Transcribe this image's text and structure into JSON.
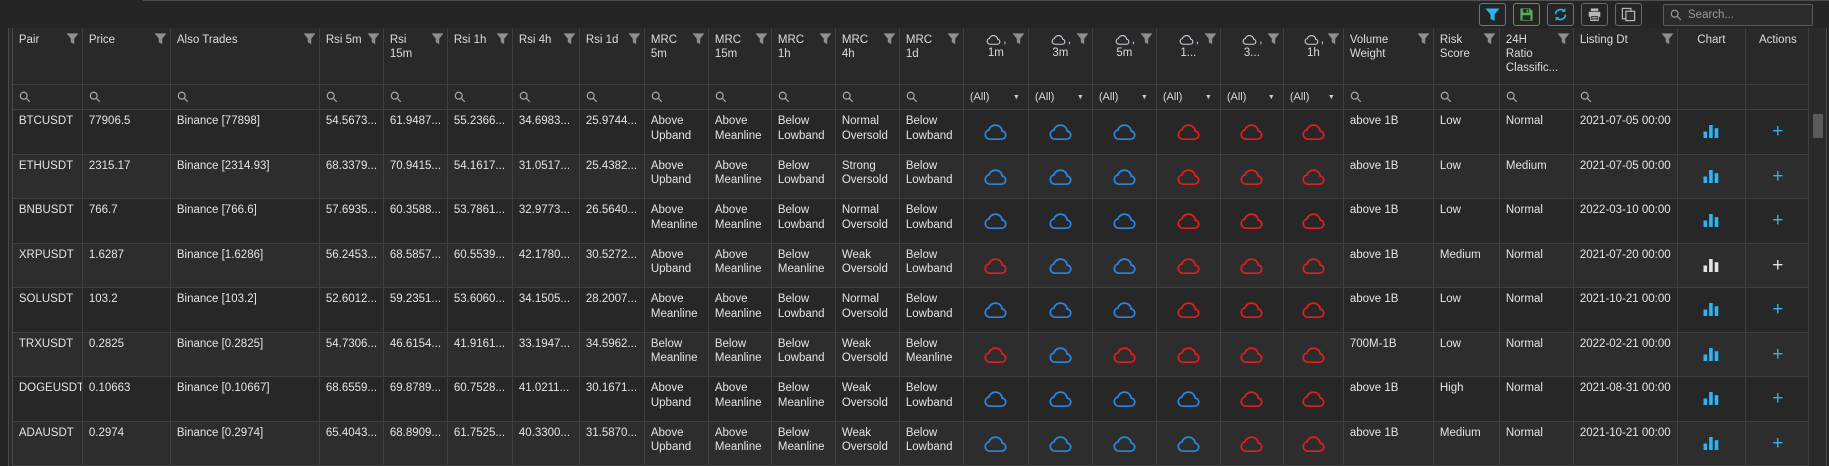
{
  "toolbar": {
    "search": {
      "placeholder": "Search..."
    },
    "buttons": [
      {
        "id": "filter",
        "icon": "funnel-icon",
        "style": "cyan"
      },
      {
        "id": "save-layout",
        "icon": "save-icon",
        "style": "green"
      },
      {
        "id": "refresh",
        "icon": "refresh-icon",
        "style": "cyan"
      },
      {
        "id": "print",
        "icon": "printer-icon",
        "style": "gray"
      },
      {
        "id": "copy",
        "icon": "copy-icon",
        "style": "gray"
      }
    ]
  },
  "table": {
    "filter_all_label": "(All)",
    "cloud_comma": ",",
    "columns": [
      {
        "id": "pair",
        "label": "Pair",
        "label_lines": [
          "Pair"
        ],
        "filter": "search",
        "funnel": true,
        "kind": "text"
      },
      {
        "id": "price",
        "label": "Price",
        "label_lines": [
          "Price"
        ],
        "filter": "search",
        "funnel": true,
        "kind": "text"
      },
      {
        "id": "also_trades",
        "label": "Also Trades",
        "label_lines": [
          "Also Trades"
        ],
        "filter": "search",
        "funnel": true,
        "kind": "text"
      },
      {
        "id": "rsi_5m",
        "label": "Rsi 5m",
        "label_lines": [
          "Rsi 5m"
        ],
        "filter": "search",
        "funnel": true,
        "kind": "text"
      },
      {
        "id": "rsi_15m",
        "label": "Rsi 15m",
        "label_lines": [
          "Rsi",
          "15m"
        ],
        "filter": "search",
        "funnel": true,
        "kind": "text"
      },
      {
        "id": "rsi_1h",
        "label": "Rsi 1h",
        "label_lines": [
          "Rsi 1h"
        ],
        "filter": "search",
        "funnel": true,
        "kind": "text"
      },
      {
        "id": "rsi_4h",
        "label": "Rsi 4h",
        "label_lines": [
          "Rsi 4h"
        ],
        "filter": "search",
        "funnel": true,
        "kind": "text"
      },
      {
        "id": "rsi_1d",
        "label": "Rsi 1d",
        "label_lines": [
          "Rsi 1d"
        ],
        "filter": "search",
        "funnel": true,
        "kind": "text"
      },
      {
        "id": "mrc_5m",
        "label": "MRC 5m",
        "label_lines": [
          "MRC",
          "5m"
        ],
        "filter": "search",
        "funnel": true,
        "kind": "text"
      },
      {
        "id": "mrc_15m",
        "label": "MRC 15m",
        "label_lines": [
          "MRC",
          "15m"
        ],
        "filter": "search",
        "funnel": true,
        "kind": "text"
      },
      {
        "id": "mrc_1h",
        "label": "MRC 1h",
        "label_lines": [
          "MRC",
          "1h"
        ],
        "filter": "search",
        "funnel": true,
        "kind": "text"
      },
      {
        "id": "mrc_4h",
        "label": "MRC 4h",
        "label_lines": [
          "MRC",
          "4h"
        ],
        "filter": "search",
        "funnel": true,
        "kind": "text"
      },
      {
        "id": "mrc_1d",
        "label": "MRC 1d",
        "label_lines": [
          "MRC",
          "1d"
        ],
        "filter": "search",
        "funnel": true,
        "kind": "text"
      },
      {
        "id": "cloud_1m",
        "label": "1m",
        "label_lines": [
          "1m"
        ],
        "cloud_header": true,
        "filter": "all",
        "funnel": true,
        "kind": "cloud"
      },
      {
        "id": "cloud_3m",
        "label": "3m",
        "label_lines": [
          "3m"
        ],
        "cloud_header": true,
        "filter": "all",
        "funnel": true,
        "kind": "cloud"
      },
      {
        "id": "cloud_5m",
        "label": "5m",
        "label_lines": [
          "5m"
        ],
        "cloud_header": true,
        "filter": "all",
        "funnel": true,
        "kind": "cloud"
      },
      {
        "id": "cloud_1x",
        "label": "1...",
        "label_lines": [
          "1..."
        ],
        "cloud_header": true,
        "filter": "all",
        "funnel": true,
        "kind": "cloud"
      },
      {
        "id": "cloud_3x",
        "label": "3...",
        "label_lines": [
          "3..."
        ],
        "cloud_header": true,
        "filter": "all",
        "funnel": true,
        "kind": "cloud"
      },
      {
        "id": "cloud_1h",
        "label": "1h",
        "label_lines": [
          "1h"
        ],
        "cloud_header": true,
        "filter": "all",
        "funnel": true,
        "kind": "cloud"
      },
      {
        "id": "volume_weight",
        "label": "Volume Weight",
        "label_lines": [
          "Volume",
          "Weight"
        ],
        "filter": "search",
        "funnel": true,
        "kind": "text"
      },
      {
        "id": "risk_score",
        "label": "Risk Score",
        "label_lines": [
          "Risk",
          "Score"
        ],
        "filter": "search",
        "funnel": true,
        "kind": "text"
      },
      {
        "id": "ratio_24h",
        "label": "24H Ratio Classific...",
        "label_lines": [
          "24H",
          "Ratio",
          "Classific..."
        ],
        "filter": "search",
        "funnel": true,
        "kind": "text"
      },
      {
        "id": "listing_dt",
        "label": "Listing Dt",
        "label_lines": [
          "Listing Dt"
        ],
        "filter": "search",
        "funnel": true,
        "kind": "text"
      },
      {
        "id": "chart",
        "label": "Chart",
        "label_lines": [
          "Chart"
        ],
        "filter": "none",
        "funnel": false,
        "kind": "chart"
      },
      {
        "id": "actions",
        "label": "Actions",
        "label_lines": [
          "Actions"
        ],
        "filter": "none",
        "funnel": false,
        "kind": "action"
      }
    ],
    "rows": [
      {
        "pair": "BTCUSDT",
        "price": "77906.5",
        "also_trades": "Binance [77898]",
        "rsi_5m": "54.5673...",
        "rsi_15m": "61.9487...",
        "rsi_1h": "55.2366...",
        "rsi_4h": "34.6983...",
        "rsi_1d": "25.9744...",
        "mrc_5m": "Above Upband",
        "mrc_15m": "Above Meanline",
        "mrc_1h": "Below Lowband",
        "mrc_4h": "Normal Oversold",
        "mrc_1d": "Below Lowband",
        "cloud_1m": "blue",
        "cloud_3m": "blue",
        "cloud_5m": "blue",
        "cloud_1x": "red",
        "cloud_3x": "red",
        "cloud_1h": "red",
        "volume_weight": "above 1B",
        "risk_score": "Low",
        "ratio_24h": "Normal",
        "listing_dt": "2021-07-05 00:00",
        "chart": "blue",
        "actions": "blue"
      },
      {
        "pair": "ETHUSDT",
        "price": "2315.17",
        "also_trades": "Binance [2314.93]",
        "rsi_5m": "68.3379...",
        "rsi_15m": "70.9415...",
        "rsi_1h": "54.1617...",
        "rsi_4h": "31.0517...",
        "rsi_1d": "25.4382...",
        "mrc_5m": "Above Upband",
        "mrc_15m": "Above Meanline",
        "mrc_1h": "Below Lowband",
        "mrc_4h": "Strong Oversold",
        "mrc_1d": "Below Lowband",
        "cloud_1m": "blue",
        "cloud_3m": "blue",
        "cloud_5m": "blue",
        "cloud_1x": "red",
        "cloud_3x": "red",
        "cloud_1h": "red",
        "volume_weight": "above 1B",
        "risk_score": "Low",
        "ratio_24h": "Medium",
        "listing_dt": "2021-07-05 00:00",
        "chart": "blue",
        "actions": "blue"
      },
      {
        "pair": "BNBUSDT",
        "price": "766.7",
        "also_trades": "Binance [766.6]",
        "rsi_5m": "57.6935...",
        "rsi_15m": "60.3588...",
        "rsi_1h": "53.7861...",
        "rsi_4h": "32.9773...",
        "rsi_1d": "26.5640...",
        "mrc_5m": "Above Meanline",
        "mrc_15m": "Above Meanline",
        "mrc_1h": "Below Lowband",
        "mrc_4h": "Normal Oversold",
        "mrc_1d": "Below Lowband",
        "cloud_1m": "blue",
        "cloud_3m": "blue",
        "cloud_5m": "blue",
        "cloud_1x": "red",
        "cloud_3x": "red",
        "cloud_1h": "red",
        "volume_weight": "above 1B",
        "risk_score": "Low",
        "ratio_24h": "Normal",
        "listing_dt": "2022-03-10 00:00",
        "chart": "blue",
        "actions": "blue"
      },
      {
        "pair": "XRPUSDT",
        "price": "1.6287",
        "also_trades": "Binance [1.6286]",
        "rsi_5m": "56.2453...",
        "rsi_15m": "68.5857...",
        "rsi_1h": "60.5539...",
        "rsi_4h": "42.1780...",
        "rsi_1d": "30.5272...",
        "mrc_5m": "Above Upband",
        "mrc_15m": "Above Meanline",
        "mrc_1h": "Below Meanline",
        "mrc_4h": "Weak Oversold",
        "mrc_1d": "Below Lowband",
        "cloud_1m": "red",
        "cloud_3m": "blue",
        "cloud_5m": "blue",
        "cloud_1x": "red",
        "cloud_3x": "red",
        "cloud_1h": "red",
        "volume_weight": "above 1B",
        "risk_score": "Medium",
        "ratio_24h": "Normal",
        "listing_dt": "2021-07-20 00:00",
        "chart": "white",
        "actions": "white"
      },
      {
        "pair": "SOLUSDT",
        "price": "103.2",
        "also_trades": "Binance [103.2]",
        "rsi_5m": "52.6012...",
        "rsi_15m": "59.2351...",
        "rsi_1h": "53.6060...",
        "rsi_4h": "34.1505...",
        "rsi_1d": "28.2007...",
        "mrc_5m": "Above Meanline",
        "mrc_15m": "Above Meanline",
        "mrc_1h": "Below Lowband",
        "mrc_4h": "Normal Oversold",
        "mrc_1d": "Below Lowband",
        "cloud_1m": "blue",
        "cloud_3m": "blue",
        "cloud_5m": "blue",
        "cloud_1x": "red",
        "cloud_3x": "red",
        "cloud_1h": "red",
        "volume_weight": "above 1B",
        "risk_score": "Low",
        "ratio_24h": "Normal",
        "listing_dt": "2021-10-21 00:00",
        "chart": "blue",
        "actions": "blue"
      },
      {
        "pair": "TRXUSDT",
        "price": "0.2825",
        "also_trades": "Binance [0.2825]",
        "rsi_5m": "54.7306...",
        "rsi_15m": "46.6154...",
        "rsi_1h": "41.9161...",
        "rsi_4h": "33.1947...",
        "rsi_1d": "34.5962...",
        "mrc_5m": "Below Meanline",
        "mrc_15m": "Below Meanline",
        "mrc_1h": "Below Lowband",
        "mrc_4h": "Weak Oversold",
        "mrc_1d": "Below Meanline",
        "cloud_1m": "red",
        "cloud_3m": "blue",
        "cloud_5m": "red",
        "cloud_1x": "red",
        "cloud_3x": "red",
        "cloud_1h": "red",
        "volume_weight": "700M-1B",
        "risk_score": "Low",
        "ratio_24h": "Normal",
        "listing_dt": "2022-02-21 00:00",
        "chart": "blue",
        "actions": "blue"
      },
      {
        "pair": "DOGEUSDT",
        "price": "0.10663",
        "also_trades": "Binance [0.10667]",
        "rsi_5m": "68.6559...",
        "rsi_15m": "69.8789...",
        "rsi_1h": "60.7528...",
        "rsi_4h": "41.0211...",
        "rsi_1d": "30.1671...",
        "mrc_5m": "Above Upband",
        "mrc_15m": "Above Meanline",
        "mrc_1h": "Below Meanline",
        "mrc_4h": "Weak Oversold",
        "mrc_1d": "Below Lowband",
        "cloud_1m": "blue",
        "cloud_3m": "blue",
        "cloud_5m": "blue",
        "cloud_1x": "blue",
        "cloud_3x": "red",
        "cloud_1h": "red",
        "volume_weight": "above 1B",
        "risk_score": "High",
        "ratio_24h": "Normal",
        "listing_dt": "2021-08-31 00:00",
        "chart": "blue",
        "actions": "blue"
      },
      {
        "pair": "ADAUSDT",
        "price": "0.2974",
        "also_trades": "Binance [0.2974]",
        "rsi_5m": "65.4043...",
        "rsi_15m": "68.8909...",
        "rsi_1h": "61.7525...",
        "rsi_4h": "40.3300...",
        "rsi_1d": "31.5870...",
        "mrc_5m": "Above Upband",
        "mrc_15m": "Above Meanline",
        "mrc_1h": "Below Meanline",
        "mrc_4h": "Weak Oversold",
        "mrc_1d": "Below Lowband",
        "cloud_1m": "blue",
        "cloud_3m": "blue",
        "cloud_5m": "blue",
        "cloud_1x": "blue",
        "cloud_3x": "red",
        "cloud_1h": "red",
        "volume_weight": "above 1B",
        "risk_score": "Medium",
        "ratio_24h": "Normal",
        "listing_dt": "2021-10-21 00:00",
        "chart": "blue",
        "actions": "blue"
      }
    ]
  },
  "colors": {
    "cloud_blue": "#2b86e3",
    "cloud_red": "#e01f1f",
    "icon_blue": "#29b6f6",
    "icon_white": "#e3e3e3",
    "accent_green": "#57ab5a",
    "funnel_gray": "#8f8f8f"
  }
}
